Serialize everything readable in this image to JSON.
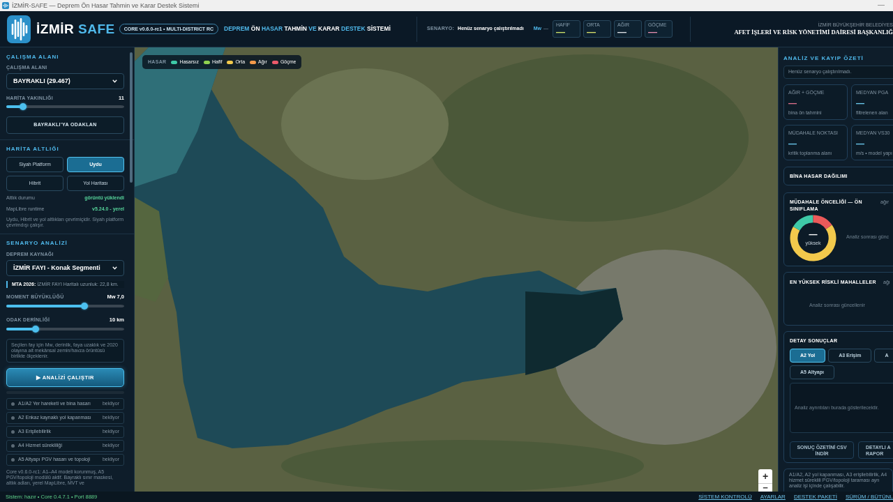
{
  "window": {
    "title": "İZMİR-SAFE — Deprem Ön Hasar Tahmin ve Karar Destek Sistemi"
  },
  "header": {
    "brand": [
      {
        "text": "İZMİR",
        "accent": false
      },
      {
        "text": "SAFE",
        "accent": true
      }
    ],
    "version_badge": "CORE v0.6.0-rc1 • MULTI-DISTRICT RC",
    "system_title": [
      {
        "text": "DEPREM",
        "accent": true
      },
      {
        "text": "ÖN",
        "accent": false
      },
      {
        "text": "HASAR",
        "accent": true
      },
      {
        "text": "TAHMİN",
        "accent": false
      },
      {
        "text": "VE",
        "accent": true
      },
      {
        "text": "KARAR",
        "accent": false
      },
      {
        "text": "DESTEK",
        "accent": true
      },
      {
        "text": "SİSTEMİ",
        "accent": false
      }
    ],
    "scenario_label": "SENARYO:",
    "scenario_value": "Henüz senaryo çalıştırılmadı",
    "magnitude_unit": "Mw",
    "magnitude_value": "—",
    "damage_counts": [
      {
        "label": "HAFİF",
        "value": "—",
        "color": "#cfe36a"
      },
      {
        "label": "ORTA",
        "value": "—",
        "color": "#d9e06a"
      },
      {
        "label": "AĞIR",
        "value": "—",
        "color": "#dfe3e6"
      },
      {
        "label": "GÖÇME",
        "value": "—",
        "color": "#e78fb0"
      }
    ],
    "organization": "İZMİR BÜYÜKŞEHİR BELEDİYES",
    "department": "AFET İŞLERİ VE RİSK YÖNETİMİ DAİRESİ BAŞKANLIĞ"
  },
  "sidebar": {
    "work_area": {
      "heading": "ÇALIŞMA ALANI",
      "label": "ÇALIŞMA ALANI",
      "district": "BAYRAKLI (29.467)",
      "zoom_label": "HARİTA YAKINLIĞI",
      "zoom_value": "11",
      "zoom": {
        "level": 0.14
      },
      "focus_button": "BAYRAKLI'YA ODAKLAN"
    },
    "basemap": {
      "heading": "HARİTA ALTLIĞI",
      "options": [
        {
          "label": "Siyah Platform",
          "selected": false
        },
        {
          "label": "Uydu",
          "selected": true
        },
        {
          "label": "Hibrit",
          "selected": false
        },
        {
          "label": "Yol Haritası",
          "selected": false
        }
      ],
      "status_rows": [
        {
          "label": "Altlık durumu",
          "value": "görüntü yüklendi"
        },
        {
          "label": "MapLibre runtime",
          "value": "v5.24.0 - yerel"
        }
      ],
      "note": "Uydu, Hibrit ve yol altlıkları çevrimiçidir. Siyah platform çevrimdışı çalışır."
    },
    "scenario": {
      "heading": "SENARYO ANALİZİ",
      "source_label": "DEPREM KAYNAĞI",
      "source": "İZMİR FAYI - Konak Segmenti",
      "source_info": "**MTA 2026:** İZMİR FAYI Haritalı uzunluk: 22,8 km.",
      "sliders": [
        {
          "label": "MOMENT BÜYÜKLÜĞÜ",
          "reading": "Mw 7,0",
          "level": 0.66
        },
        {
          "label": "ODAK DERİNLİĞİ",
          "reading": "10 km",
          "level": 0.25
        }
      ],
      "note": "Seçilen fay için Mw, derinlik, faya uzaklık ve 2020 olayına ait mekânsal zemin/havza örüntüsü birlikte ölçeklenir.",
      "run_button": "▶ ANALİZİ ÇALIŞTIR",
      "steps": [
        {
          "label": "A1/A2 Yer hareketi ve bina hasarı",
          "status": "bekliyor",
          "done": false
        },
        {
          "label": "A2 Enkaz kaynaklı yol kapanması",
          "status": "bekliyor",
          "done": false
        },
        {
          "label": "A3 Erişilebilirlik",
          "status": "bekliyor",
          "done": false
        },
        {
          "label": "A4 Hizmet sürekliliği",
          "status": "bekliyor",
          "done": false
        },
        {
          "label": "A5 Altyapı PGV hasarı ve topoloji",
          "status": "bekliyor",
          "done": false
        }
      ],
      "footnote": "Core v0.6.0-rc1: A1–A4 modeli korunmuş, A5 PGV/topoloji modülü aktif. Bayraklı sınır maskesi, altlık adları, yerel MapLibre, MVT ve"
    }
  },
  "map": {
    "legend": {
      "title": "HASAR",
      "items": [
        {
          "label": "Hasarsız",
          "color": "#3ec9a7"
        },
        {
          "label": "Hafif",
          "color": "#8fd14f"
        },
        {
          "label": "Orta",
          "color": "#f2c94c"
        },
        {
          "label": "Ağır",
          "color": "#f2994a"
        },
        {
          "label": "Göçme",
          "color": "#eb5a6a"
        }
      ]
    },
    "zoom_in": "+",
    "zoom_out": "−"
  },
  "summary": {
    "heading": "ANALİZ VE KAYIP ÖZETİ",
    "status": "Henüz senaryo çalıştırılmadı.",
    "stats": [
      {
        "label": "AĞIR + GÖÇME",
        "value": "—",
        "caption": "bina ön tahmini",
        "color": "#e0708c"
      },
      {
        "label": "MEDYAN PGA",
        "value": "—",
        "caption": "filtrelenen alan",
        "color": "#6ccbef"
      },
      {
        "label": "MÜDAHALE NOKTASI",
        "value": "—",
        "caption": "kritik toplanma alanı",
        "color": "#6ccbef"
      },
      {
        "label": "MEDYAN VS30",
        "value": "—",
        "caption": "m/s • model yapı",
        "color": "#6ccbef"
      }
    ],
    "damage_distribution": {
      "title": "BİNA HASAR DAĞILIMI"
    },
    "priority": {
      "title": "MÜDAHALE ÖNCELİĞİ — ÖN SINIFLAMA",
      "side_note": "ağır",
      "center_value": "—",
      "center_label": "yüksek",
      "empty_text": "Analiz sonrası günc"
    },
    "top_risk": {
      "title": "EN YÜKSEK RİSKLİ MAHALLELER",
      "side_note": "ağı",
      "empty_text": "Analiz sonrası güncellenir"
    },
    "details": {
      "title": "DETAY SONUÇLAR",
      "tabs": [
        {
          "label": "A2 Yol",
          "selected": true
        },
        {
          "label": "A3 Erişim",
          "selected": false
        },
        {
          "label": "A",
          "selected": false
        },
        {
          "label": "A5 Altyapı",
          "selected": false
        }
      ],
      "empty_text": "Analiz ayrıntıları burada gösterilecektir.",
      "buttons": [
        "SONUÇ ÖZETİNİ CSV İNDİR",
        "DETAYLI A\nRAPOR"
      ]
    },
    "footnote": "A1/A2, A2 yol kapanması, A3 erişilebilirlik, A4 hizmet süreklili PGV/topoloji taraması ayrı analiz işi içinde çalışabilir."
  },
  "status_bar": {
    "status": "Sistem: hazır • Core 0.4.7.1 • Port 8889",
    "links": [
      "SİSTEM KONTROLÜ",
      "AYARLAR",
      "DESTEK PAKETİ",
      "SÜRÜM / BÜTÜNL"
    ]
  }
}
